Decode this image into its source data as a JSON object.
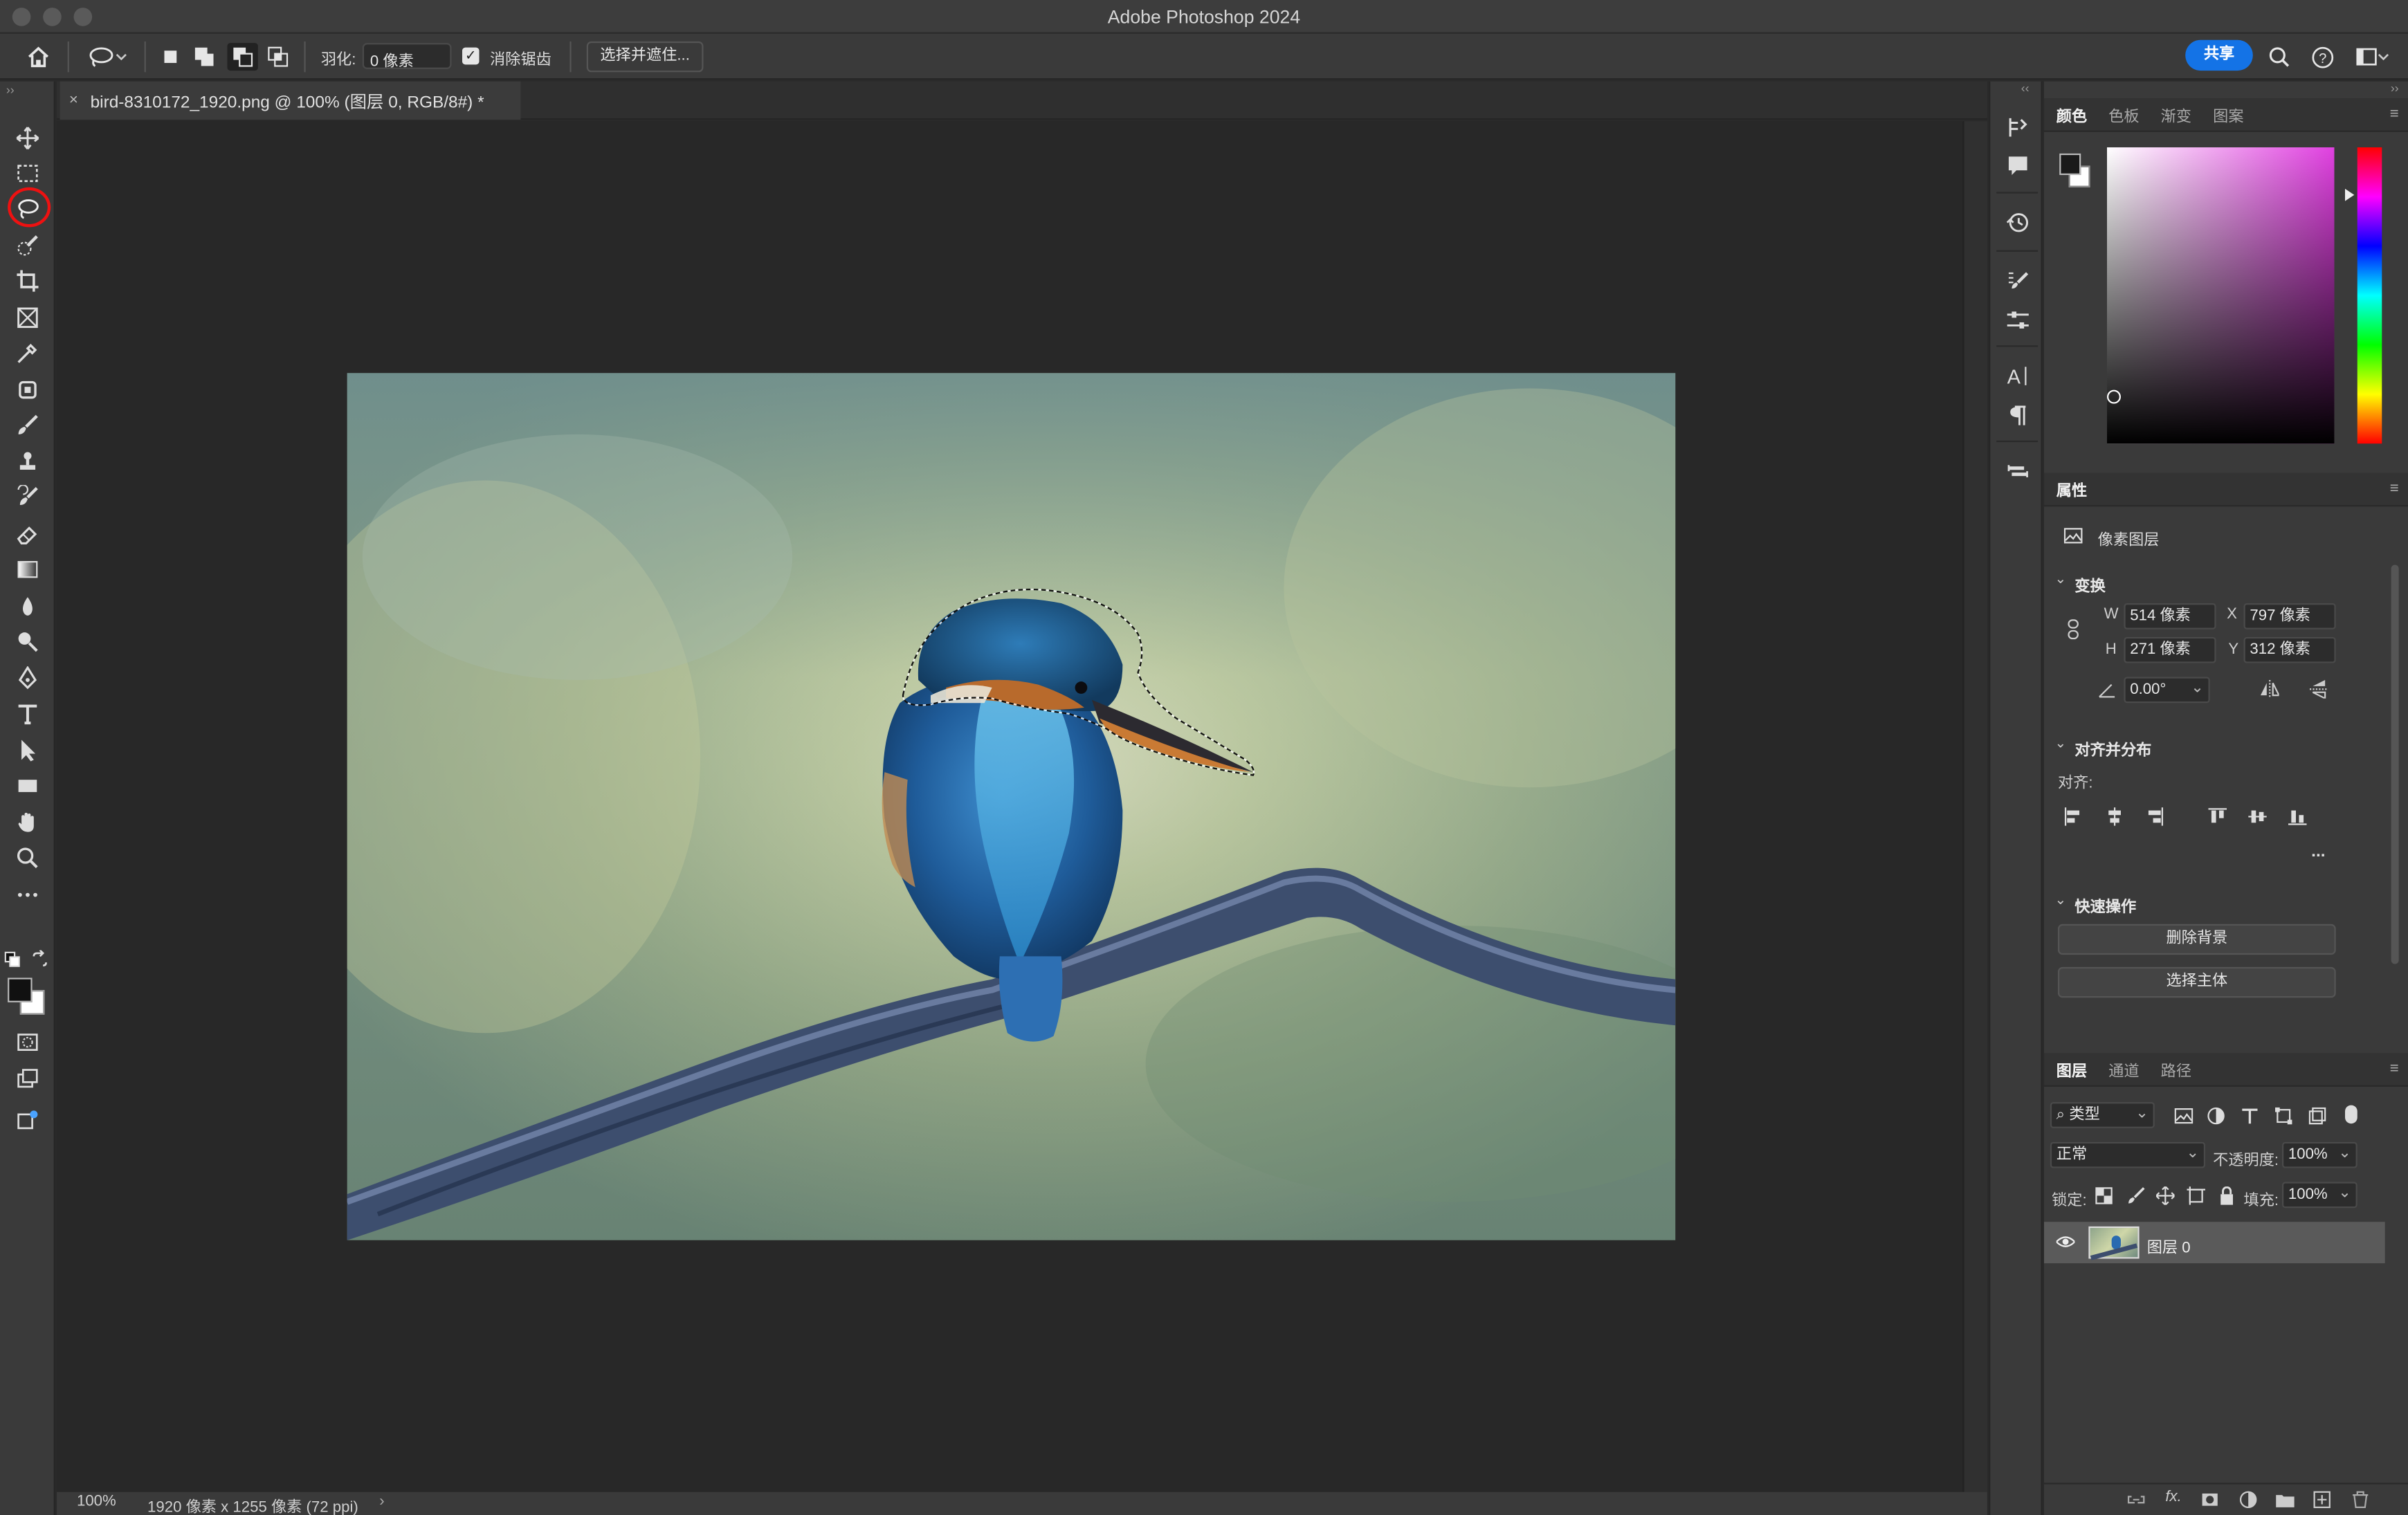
{
  "app": {
    "title": "Adobe Photoshop 2024"
  },
  "options_bar": {
    "feather_label": "羽化:",
    "feather_value": "0 像素",
    "antialias_label": "消除锯齿",
    "antialias_checked": true,
    "select_mask_label": "选择并遮住...",
    "share_label": "共享"
  },
  "document": {
    "tab_title": "bird-8310172_1920.png @ 100% (图层 0, RGB/8#) *",
    "modified": true
  },
  "status": {
    "zoom": "100%",
    "dimensions": "1920 像素 x 1255 像素 (72 ppi)"
  },
  "color_panel": {
    "tabs": [
      "颜色",
      "色板",
      "渐变",
      "图案"
    ],
    "active_tab": "颜色",
    "hue_color": "#e040e0",
    "foreground_color": "#1a1a1a",
    "background_color": "#ffffff"
  },
  "properties_panel": {
    "tab": "属性",
    "layer_type": "像素图层",
    "transform_label": "变换",
    "w_label": "W",
    "w_value": "514 像素",
    "h_label": "H",
    "h_value": "271 像素",
    "x_label": "X",
    "x_value": "797 像素",
    "y_label": "Y",
    "y_value": "312 像素",
    "angle_value": "0.00°",
    "align_label": "对齐并分布",
    "align_sub": "对齐:",
    "more": "...",
    "quick_actions_label": "快速操作",
    "remove_bg": "删除背景",
    "select_subject": "选择主体"
  },
  "layers_panel": {
    "tabs": [
      "图层",
      "通道",
      "路径"
    ],
    "active_tab": "图层",
    "filter_label": "类型",
    "blend_mode": "正常",
    "opacity_label": "不透明度:",
    "opacity_value": "100%",
    "lock_label": "锁定:",
    "fill_label": "填充:",
    "fill_value": "100%",
    "layers": [
      {
        "name": "图层 0",
        "visible": true
      }
    ]
  },
  "toolbar": {
    "active_tool": "lasso-tool"
  }
}
